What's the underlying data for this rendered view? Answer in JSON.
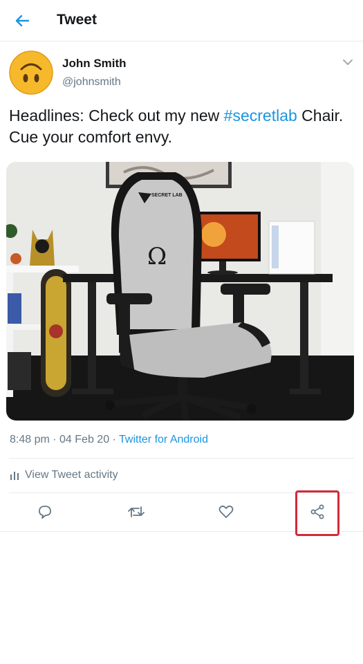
{
  "header": {
    "title": "Tweet"
  },
  "author": {
    "name": "John Smith",
    "handle": "@johnsmith"
  },
  "tweet": {
    "text_before": "Headlines: Check out my new ",
    "hashtag": "#secretlab",
    "text_after": " Chair. Cue your comfort envy."
  },
  "media": {
    "chair_brand": "SECRET LAB",
    "chair_logo": "Ω"
  },
  "meta": {
    "timestamp": "8:48 pm · 04 Feb 20 · ",
    "source": "Twitter for Android"
  },
  "activity": {
    "label": "View Tweet activity"
  },
  "actions": {
    "reply_icon": "reply-icon",
    "retweet_icon": "retweet-icon",
    "like_icon": "heart-icon",
    "share_icon": "share-icon"
  },
  "colors": {
    "accent": "#1b95e0",
    "highlight": "#d62839",
    "muted": "#657786"
  }
}
